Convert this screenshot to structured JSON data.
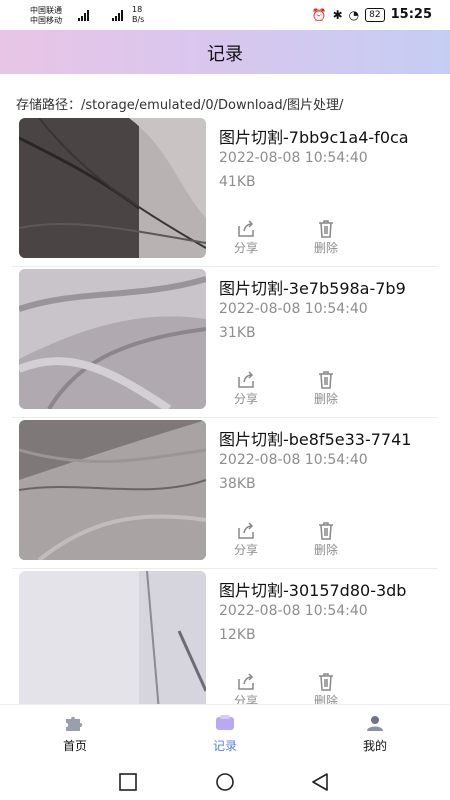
{
  "status_bar": {
    "carrier1": "中国联通",
    "carrier2": "中国移动",
    "net_speed_value": "18",
    "net_speed_unit": "B/s",
    "battery": "82",
    "time": "15:25"
  },
  "header": {
    "title": "记录"
  },
  "storage": {
    "label": "存储路径：",
    "path": "/storage/emulated/0/Download/图片处理/"
  },
  "actions": {
    "share": "分享",
    "delete": "删除"
  },
  "records": [
    {
      "name": "图片切割-7bb9c1a4-f0ca",
      "date": "2022-08-08 10:54:40",
      "size": "41KB"
    },
    {
      "name": "图片切割-3e7b598a-7b9",
      "date": "2022-08-08 10:54:40",
      "size": "31KB"
    },
    {
      "name": "图片切割-be8f5e33-7741",
      "date": "2022-08-08 10:54:40",
      "size": "38KB"
    },
    {
      "name": "图片切割-30157d80-3db",
      "date": "2022-08-08 10:54:40",
      "size": "12KB"
    }
  ],
  "tabs": [
    {
      "label": "首页",
      "icon": "puzzle-icon"
    },
    {
      "label": "记录",
      "icon": "record-icon",
      "active": true
    },
    {
      "label": "我的",
      "icon": "profile-icon"
    }
  ],
  "colors": {
    "header_gradient_start": "#e8c5e6",
    "header_gradient_end": "#c6cdf3",
    "active_tab": "#5a7fe0",
    "muted_text": "#8e8e8e"
  }
}
